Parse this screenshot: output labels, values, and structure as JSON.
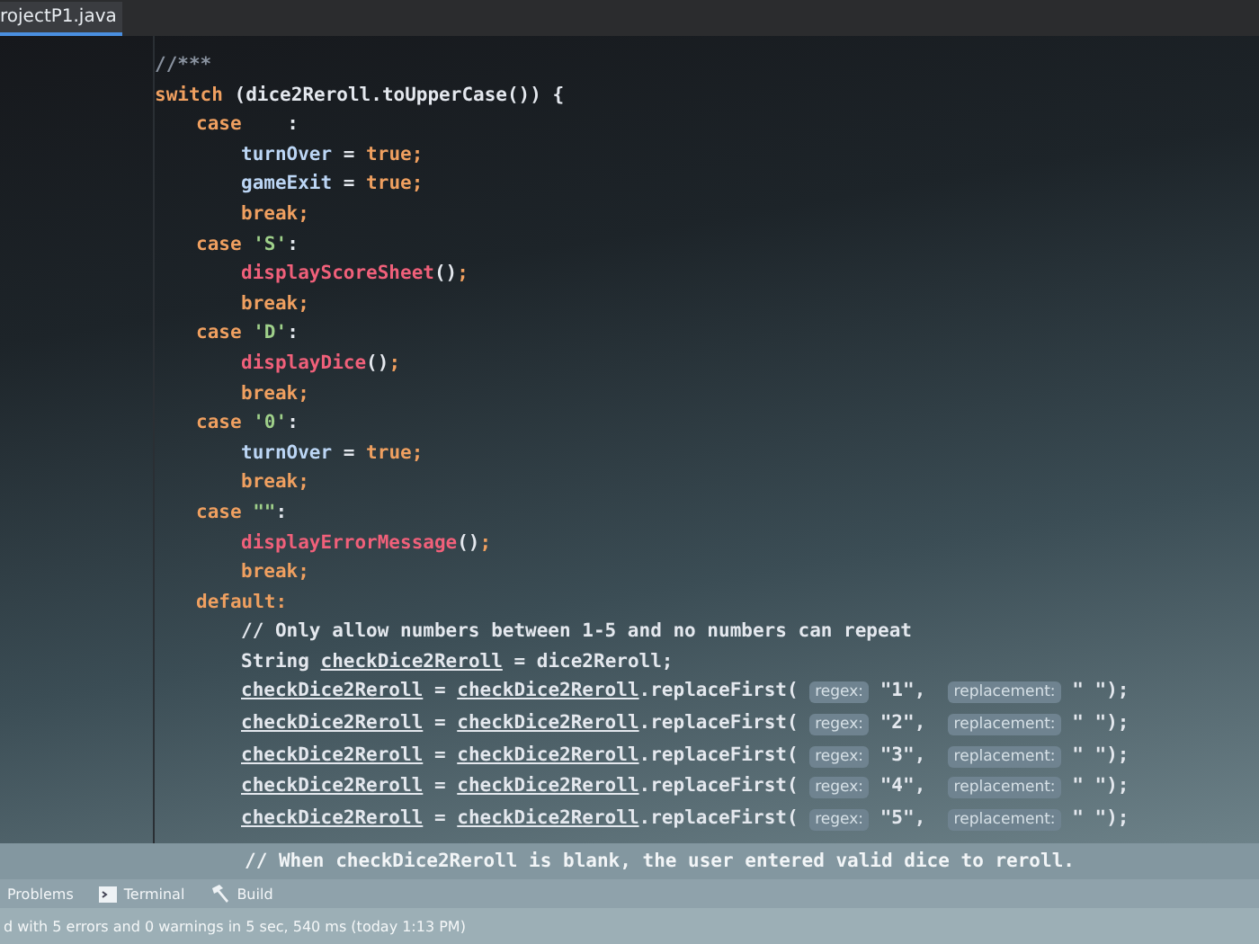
{
  "tab": {
    "label": "rojectP1.java",
    "selected": true
  },
  "code_lines": [
    {
      "tokens": [
        {
          "kind": "comment",
          "text": "//***"
        }
      ]
    },
    {
      "tokens": [
        {
          "kind": "keyword",
          "text": "switch"
        },
        {
          "kind": "plain",
          "text": " (dice2Reroll.toUpperCase()) {"
        }
      ],
      "children": [
        {
          "tokens": [
            {
              "kind": "keyword",
              "text": "case"
            },
            {
              "kind": "plain",
              "text": "    :"
            }
          ],
          "children": [
            {
              "tokens": [
                {
                  "kind": "field",
                  "text": "turnOver"
                },
                {
                  "kind": "plain",
                  "text": " = "
                },
                {
                  "kind": "keyword",
                  "text": "true;"
                }
              ]
            },
            {
              "tokens": [
                {
                  "kind": "field",
                  "text": "gameExit"
                },
                {
                  "kind": "plain",
                  "text": " = "
                },
                {
                  "kind": "keyword",
                  "text": "true;"
                }
              ]
            },
            {
              "tokens": [
                {
                  "kind": "keyword",
                  "text": "break;"
                }
              ]
            }
          ]
        },
        {
          "tokens": [
            {
              "kind": "keyword",
              "text": "case "
            },
            {
              "kind": "string",
              "text": "'S'"
            },
            {
              "kind": "plain",
              "text": ":"
            }
          ],
          "children": [
            {
              "tokens": [
                {
                  "kind": "call",
                  "text": "displayScoreSheet"
                },
                {
                  "kind": "plain",
                  "text": "()"
                },
                {
                  "kind": "keyword",
                  "text": ";"
                }
              ]
            },
            {
              "tokens": [
                {
                  "kind": "keyword",
                  "text": "break;"
                }
              ]
            }
          ]
        },
        {
          "tokens": [
            {
              "kind": "keyword",
              "text": "case "
            },
            {
              "kind": "string",
              "text": "'D'"
            },
            {
              "kind": "plain",
              "text": ":"
            }
          ],
          "children": [
            {
              "tokens": [
                {
                  "kind": "call",
                  "text": "displayDice"
                },
                {
                  "kind": "plain",
                  "text": "()"
                },
                {
                  "kind": "keyword",
                  "text": ";"
                }
              ]
            },
            {
              "tokens": [
                {
                  "kind": "keyword",
                  "text": "break;"
                }
              ]
            }
          ]
        },
        {
          "tokens": [
            {
              "kind": "keyword",
              "text": "case "
            },
            {
              "kind": "string",
              "text": "'0'"
            },
            {
              "kind": "plain",
              "text": ":"
            }
          ],
          "children": [
            {
              "tokens": [
                {
                  "kind": "field",
                  "text": "turnOver"
                },
                {
                  "kind": "plain",
                  "text": " = "
                },
                {
                  "kind": "keyword",
                  "text": "true;"
                }
              ]
            },
            {
              "tokens": [
                {
                  "kind": "keyword",
                  "text": "break;"
                }
              ]
            }
          ]
        },
        {
          "tokens": [
            {
              "kind": "keyword",
              "text": "case "
            },
            {
              "kind": "string",
              "text": "\"\""
            },
            {
              "kind": "plain",
              "text": ":"
            }
          ],
          "children": [
            {
              "tokens": [
                {
                  "kind": "call",
                  "text": "displayErrorMessage"
                },
                {
                  "kind": "plain",
                  "text": "()"
                },
                {
                  "kind": "keyword",
                  "text": ";"
                }
              ]
            },
            {
              "tokens": [
                {
                  "kind": "keyword",
                  "text": "break;"
                }
              ]
            }
          ]
        },
        {
          "tokens": [
            {
              "kind": "keyword",
              "text": "default:"
            }
          ],
          "children": [
            {
              "tokens": [
                {
                  "kind": "plain",
                  "text": "// Only allow numbers between 1-5 and no numbers can repeat"
                }
              ]
            },
            {
              "tokens": [
                {
                  "kind": "plain",
                  "text": "String "
                },
                {
                  "kind": "var",
                  "text": "checkDice2Reroll"
                },
                {
                  "kind": "plain",
                  "text": " = dice2Reroll;"
                }
              ]
            },
            {
              "tokens": [
                {
                  "kind": "var",
                  "text": "checkDice2Reroll"
                },
                {
                  "kind": "plain",
                  "text": " = "
                },
                {
                  "kind": "var",
                  "text": "checkDice2Reroll"
                },
                {
                  "kind": "plain",
                  "text": ".replaceFirst( "
                },
                {
                  "kind": "hint",
                  "text": "regex:"
                },
                {
                  "kind": "plain",
                  "text": " \"1\",  "
                },
                {
                  "kind": "hint",
                  "text": "replacement:"
                },
                {
                  "kind": "plain",
                  "text": " \" \");"
                }
              ]
            },
            {
              "tokens": [
                {
                  "kind": "var",
                  "text": "checkDice2Reroll"
                },
                {
                  "kind": "plain",
                  "text": " = "
                },
                {
                  "kind": "var",
                  "text": "checkDice2Reroll"
                },
                {
                  "kind": "plain",
                  "text": ".replaceFirst( "
                },
                {
                  "kind": "hint",
                  "text": "regex:"
                },
                {
                  "kind": "plain",
                  "text": " \"2\",  "
                },
                {
                  "kind": "hint",
                  "text": "replacement:"
                },
                {
                  "kind": "plain",
                  "text": " \" \");"
                }
              ]
            },
            {
              "tokens": [
                {
                  "kind": "var",
                  "text": "checkDice2Reroll"
                },
                {
                  "kind": "plain",
                  "text": " = "
                },
                {
                  "kind": "var",
                  "text": "checkDice2Reroll"
                },
                {
                  "kind": "plain",
                  "text": ".replaceFirst( "
                },
                {
                  "kind": "hint",
                  "text": "regex:"
                },
                {
                  "kind": "plain",
                  "text": " \"3\",  "
                },
                {
                  "kind": "hint",
                  "text": "replacement:"
                },
                {
                  "kind": "plain",
                  "text": " \" \");"
                }
              ]
            },
            {
              "tokens": [
                {
                  "kind": "var",
                  "text": "checkDice2Reroll"
                },
                {
                  "kind": "plain",
                  "text": " = "
                },
                {
                  "kind": "var",
                  "text": "checkDice2Reroll"
                },
                {
                  "kind": "plain",
                  "text": ".replaceFirst( "
                },
                {
                  "kind": "hint",
                  "text": "regex:"
                },
                {
                  "kind": "plain",
                  "text": " \"4\",  "
                },
                {
                  "kind": "hint",
                  "text": "replacement:"
                },
                {
                  "kind": "plain",
                  "text": " \" \");"
                }
              ]
            },
            {
              "tokens": [
                {
                  "kind": "var",
                  "text": "checkDice2Reroll"
                },
                {
                  "kind": "plain",
                  "text": " = "
                },
                {
                  "kind": "var",
                  "text": "checkDice2Reroll"
                },
                {
                  "kind": "plain",
                  "text": ".replaceFirst( "
                },
                {
                  "kind": "hint",
                  "text": "regex:"
                },
                {
                  "kind": "plain",
                  "text": " \"5\",  "
                },
                {
                  "kind": "hint",
                  "text": "replacement:"
                },
                {
                  "kind": "plain",
                  "text": " \" \");"
                }
              ]
            }
          ]
        }
      ]
    }
  ],
  "current_line": "// When checkDice2Reroll is blank, the user entered valid dice to reroll.",
  "tool_tabs": [
    {
      "kind": "problems",
      "label": "Problems"
    },
    {
      "kind": "terminal",
      "label": "Terminal"
    },
    {
      "kind": "build",
      "label": "Build"
    }
  ],
  "status_bar": "d with 5 errors and 0 warnings in 5 sec, 540 ms (today 1:13 PM)"
}
